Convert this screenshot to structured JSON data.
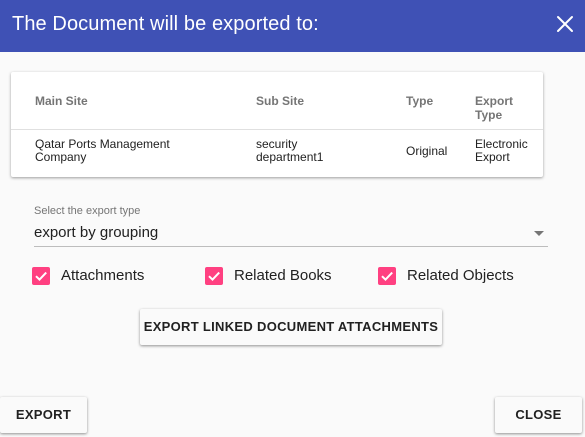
{
  "dialog": {
    "title": "The Document will be exported to:",
    "close_icon": "close-icon",
    "accent_color": "#3f51b5"
  },
  "table": {
    "headers": [
      "Main Site",
      "Sub Site",
      "Type",
      "Export Type"
    ],
    "rows": [
      [
        "Qatar Ports Management Company",
        "security department1",
        "Original",
        "Electronic Export"
      ]
    ]
  },
  "export_type": {
    "label": "Select the export type",
    "value": "export by grouping"
  },
  "checkboxes": [
    {
      "label": "Attachments",
      "checked": true
    },
    {
      "label": "Related Books",
      "checked": true
    },
    {
      "label": "Related Objects",
      "checked": true
    }
  ],
  "checkbox_color": "#ff4081",
  "linked_button": {
    "label": "EXPORT LINKED DOCUMENT ATTACHMENTS"
  },
  "footer": {
    "export_label": "EXPORT",
    "close_label": "CLOSE"
  }
}
